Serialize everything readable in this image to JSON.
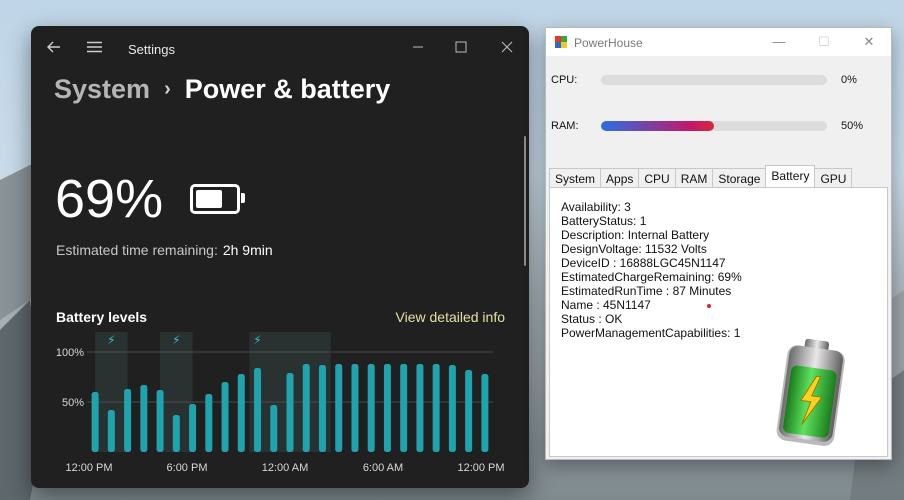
{
  "settings": {
    "title": "Settings",
    "breadcrumb_parent": "System",
    "breadcrumb_sep": "›",
    "breadcrumb_current": "Power & battery",
    "battery_percent": "69%",
    "battery_level": 0.69,
    "est_label": "Estimated time remaining:",
    "est_value": "2h 9min",
    "levels_title": "Battery levels",
    "view_link": "View detailed info"
  },
  "chart_data": {
    "type": "bar",
    "title": "Battery levels",
    "ylabels": [
      "100%",
      "50%"
    ],
    "xlabels": [
      "12:00 PM",
      "6:00 PM",
      "12:00 AM",
      "6:00 AM",
      "12:00 PM"
    ],
    "values": [
      60,
      42,
      63,
      67,
      62,
      37,
      48,
      58,
      70,
      78,
      84,
      47,
      79,
      88,
      87,
      88,
      88,
      88,
      88,
      88,
      88,
      88,
      87,
      82,
      78
    ],
    "charging_bars": [
      1,
      5,
      10
    ],
    "ylim": [
      0,
      100
    ],
    "color": "#1fa3ad"
  },
  "powerhouse": {
    "title": "PowerHouse",
    "cpu_label": "CPU:",
    "cpu_value": "0%",
    "cpu_level": 0.0,
    "ram_label": "RAM:",
    "ram_value": "50%",
    "ram_level": 0.5,
    "tabs": [
      "System",
      "Apps",
      "CPU",
      "RAM",
      "Storage",
      "Battery",
      "GPU"
    ],
    "active_tab": "Battery",
    "info_lines": [
      "Availability: 3",
      "BatteryStatus: 1",
      "Description: Internal Battery",
      "DesignVoltage: 11532 Volts",
      "DeviceID : 16888LGC45N1147",
      "EstimatedChargeRemaining: 69%",
      "EstimatedRunTime : 87 Minutes",
      "Name : 45N1147",
      "Status : OK",
      "PowerManagementCapabilities: 1"
    ]
  },
  "colors": {
    "settings_bg": "#202020",
    "accent_bar": "#1fa3ad",
    "link": "#e3e0a4"
  }
}
